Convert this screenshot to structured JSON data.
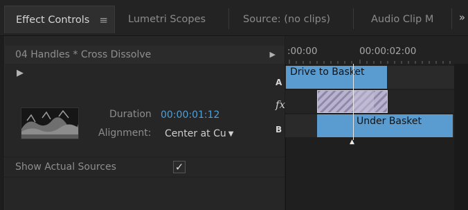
{
  "tabs": [
    {
      "label": "Effect Controls",
      "active": true
    },
    {
      "label": "Lumetri Scopes",
      "active": false
    },
    {
      "label": "Source: (no clips)",
      "active": false
    },
    {
      "label": "Audio Clip M",
      "active": false
    }
  ],
  "icons": {
    "panel_menu": "≡",
    "overflow": "»",
    "clip_arrow": "▶",
    "play": "▶",
    "caret": "▼",
    "check": "✓",
    "fx": "fx"
  },
  "clip_header": {
    "name": "04 Handles * Cross Dissolve"
  },
  "properties": {
    "duration_label": "Duration",
    "duration_value": "00:00:01:12",
    "alignment_label": "Alignment:",
    "alignment_value": "Center at Cu"
  },
  "show_sources": {
    "label": "Show Actual Sources",
    "checked": true
  },
  "timeline": {
    "timecodes": [
      ":00:00",
      "00:00:02:00"
    ],
    "track_a": "A",
    "track_b": "B",
    "clip_a_label": "Drive to Basket",
    "clip_b_label": "Under Basket"
  },
  "colors": {
    "clip_blue": "#5a9ccf",
    "timecode_blue": "#4ea0d8"
  }
}
